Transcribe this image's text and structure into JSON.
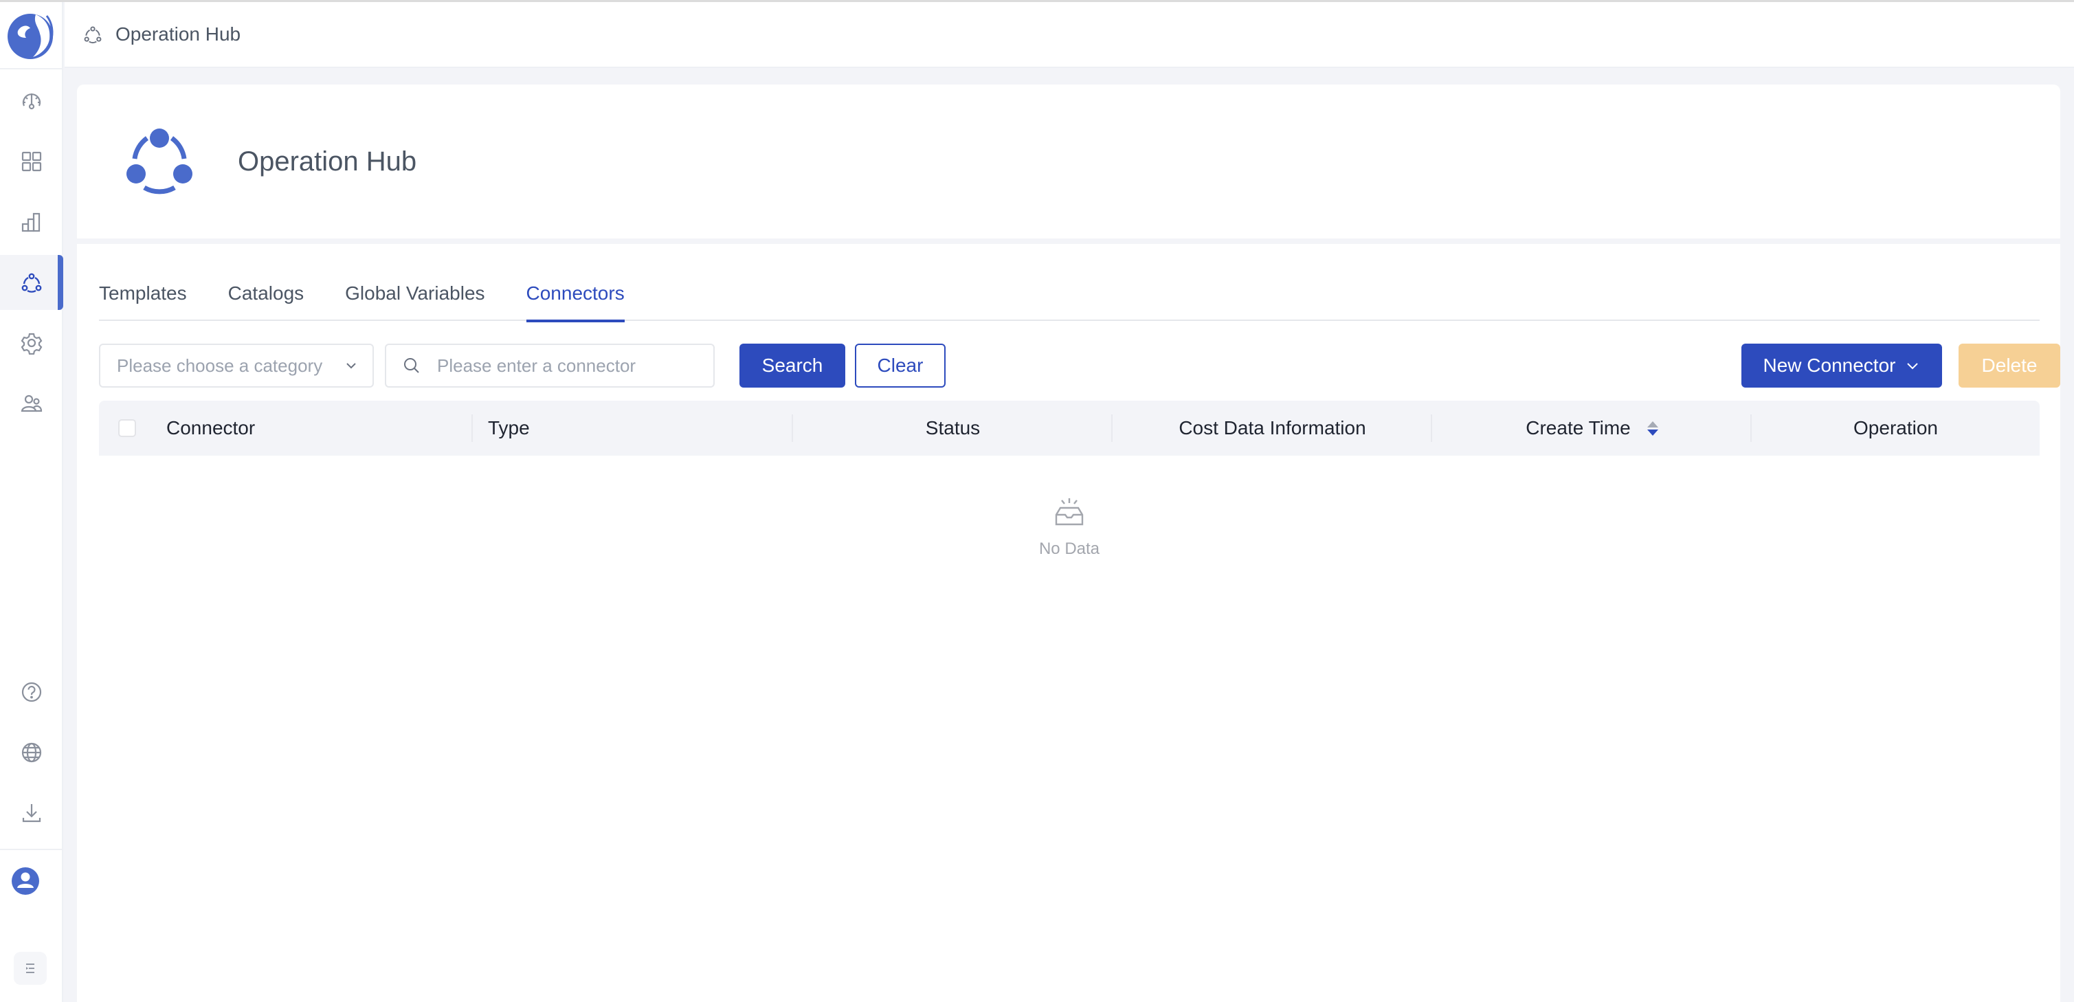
{
  "app": {
    "brand_color": "#4a6bcb",
    "primary_color": "#2d4bbd",
    "danger_disabled_color": "#f6d095"
  },
  "sidebar": {
    "logo": "company-logo",
    "items": [
      {
        "icon": "dashboard-gauge-icon",
        "label": "Dashboard",
        "active": false
      },
      {
        "icon": "apps-grid-icon",
        "label": "Applications",
        "active": false
      },
      {
        "icon": "bar-chart-icon",
        "label": "Analytics",
        "active": false
      },
      {
        "icon": "operation-hub-icon",
        "label": "Operation Hub",
        "active": true
      },
      {
        "icon": "gear-icon",
        "label": "Settings",
        "active": false
      },
      {
        "icon": "users-icon",
        "label": "Users",
        "active": false
      }
    ],
    "bottom_items": [
      {
        "icon": "help-icon",
        "label": "Help"
      },
      {
        "icon": "globe-icon",
        "label": "Language"
      },
      {
        "icon": "download-icon",
        "label": "Download"
      }
    ],
    "avatar": "user-avatar-icon",
    "collapse": "collapse-menu-icon"
  },
  "topbar": {
    "breadcrumb_icon": "operation-hub-icon",
    "title": "Operation Hub"
  },
  "hero": {
    "icon": "operation-hub-icon",
    "title": "Operation Hub"
  },
  "tabs": [
    {
      "label": "Templates",
      "active": false
    },
    {
      "label": "Catalogs",
      "active": false
    },
    {
      "label": "Global Variables",
      "active": false
    },
    {
      "label": "Connectors",
      "active": true
    }
  ],
  "toolbar": {
    "category_select": {
      "placeholder": "Please choose a category",
      "value": ""
    },
    "search_input": {
      "placeholder": "Please enter a connector",
      "value": ""
    },
    "search_label": "Search",
    "clear_label": "Clear",
    "new_connector_label": "New Connector",
    "delete_label": "Delete",
    "delete_disabled": true
  },
  "table": {
    "columns": [
      {
        "label": "Connector"
      },
      {
        "label": "Type"
      },
      {
        "label": "Status"
      },
      {
        "label": "Cost Data Information"
      },
      {
        "label": "Create Time",
        "sortable": true,
        "sort": "descending"
      },
      {
        "label": "Operation"
      }
    ],
    "rows": [],
    "empty_text": "No Data"
  }
}
